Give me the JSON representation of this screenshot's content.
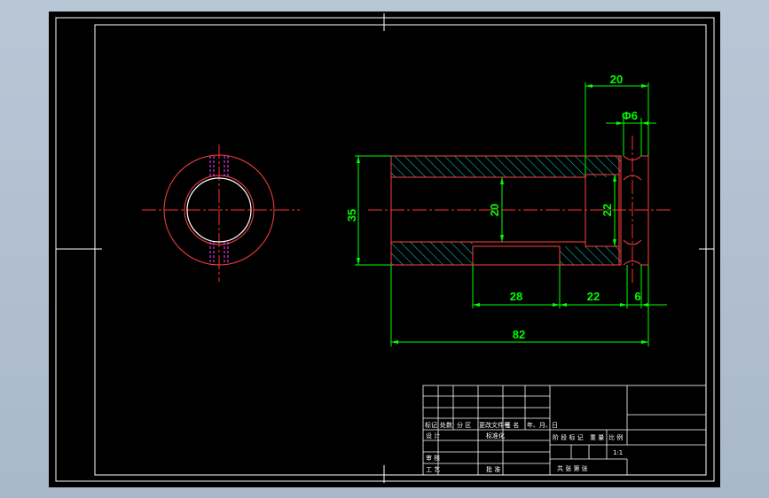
{
  "drawing": {
    "dimensions": {
      "overall_diameter": "35",
      "bore_diameter": "20",
      "counterbore_diameter": "22",
      "right_section_length": "20",
      "hole_diameter": "Φ6",
      "length_28": "28",
      "length_22": "22",
      "length_6": "6",
      "overall_length": "82"
    }
  },
  "title_block": {
    "row_labels": [
      "标记",
      "处数",
      "分 区",
      "更改文件号",
      "签 名",
      "年、月、日"
    ],
    "designer": "设 计",
    "standardization": "标准化",
    "review": "审 核",
    "process": "工 艺",
    "approve": "批 准",
    "stage_mark": "阶 段 标 记",
    "weight": "重 量",
    "scale_label": "比 例",
    "scale_value": "1:1",
    "sheet_info": "共  张  第  张"
  },
  "colors": {
    "background": "#000000",
    "outline": "#ffffff",
    "part": "#ff4040",
    "center_line": "#ff3030",
    "hatch": "#00e0e0",
    "dimension": "#00ff00",
    "hidden": "#ff40ff"
  }
}
